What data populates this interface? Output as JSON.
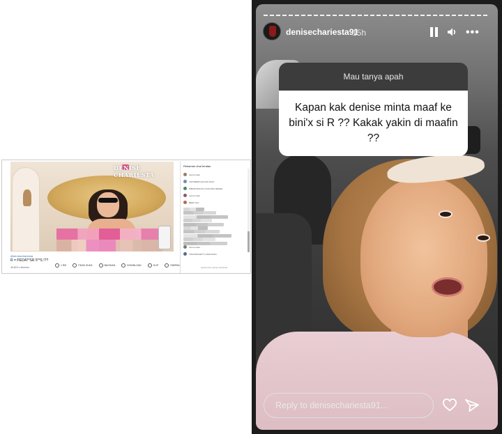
{
  "youtube": {
    "watermark": "DENISE CHARIESTA",
    "channel": "@denisechariesta",
    "video_title": "R = PEDAT*SR 5**S !??",
    "meta": "46.820 x ditonton",
    "actions": [
      {
        "label": "1 RB",
        "icon": "like-icon"
      },
      {
        "label": "TIDAK SUKA",
        "icon": "dislike-icon"
      },
      {
        "label": "BAGIKAN",
        "icon": "share-icon"
      },
      {
        "label": "DOWNLOAD",
        "icon": "download-icon"
      },
      {
        "label": "KLIP",
        "icon": "clip-icon"
      },
      {
        "label": "SIMPAN",
        "icon": "save-icon"
      },
      {
        "label": "...",
        "icon": "more-icon"
      }
    ],
    "chat": {
      "header": "Rekaman chat teratas",
      "rows": [
        {
          "text": "Lama masa",
          "color": "#9e7d5a"
        },
        {
          "text": "TAPI BERKUALITAS SAYA",
          "color": "#6b8fb8"
        },
        {
          "text": "DIBIAR BULAN LUNA KIRA SEKEN",
          "color": "#4b8a6a"
        },
        {
          "text": "Lama masa",
          "color": "#8b5a6a"
        },
        {
          "text": "BEDA Tete",
          "color": "#b86a4b"
        },
        {
          "text": "Lama masa",
          "color": "#7a7a7a"
        },
        {
          "text": "TIDA BANGETT LAMA MAKA",
          "color": "#5a6b8b"
        }
      ],
      "bottom": "powered by denise chariesta"
    }
  },
  "instagram": {
    "username": "denisechariesta91",
    "time": "15h",
    "question_header": "Mau tanya apah",
    "question_text": "Kapan kak denise minta maaf ke bini'x si R ?? Kakak yakin di maafin ??",
    "reply_placeholder": "Reply to denisechariesta91...",
    "icons": {
      "pause": "pause-icon",
      "sound": "speaker-icon",
      "more": "more-icon",
      "like": "heart-icon",
      "share": "send-icon"
    }
  }
}
